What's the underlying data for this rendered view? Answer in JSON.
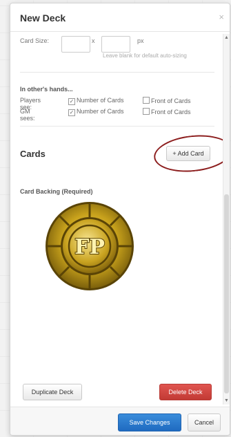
{
  "dialog": {
    "title": "New Deck",
    "close_glyph": "×"
  },
  "card_size": {
    "label": "Card Size:",
    "separator": "x",
    "unit": "px",
    "width_value": "",
    "height_value": "",
    "hint": "Leave blank for default auto-sizing"
  },
  "others_hands": {
    "title": "In other's hands...",
    "rows": [
      {
        "who": "Players see:",
        "number_of_cards": {
          "label": "Number of Cards",
          "checked": true
        },
        "front_of_cards": {
          "label": "Front of Cards",
          "checked": false
        }
      },
      {
        "who": "GM sees:",
        "number_of_cards": {
          "label": "Number of Cards",
          "checked": true
        },
        "front_of_cards": {
          "label": "Front of Cards",
          "checked": false
        }
      }
    ]
  },
  "cards": {
    "heading": "Cards",
    "add_card_label": "+ Add Card",
    "backing_label": "Card Backing (Required)",
    "backing_image": "fp-gold-token-icon"
  },
  "actions": {
    "duplicate_label": "Duplicate Deck",
    "delete_label": "Delete Deck",
    "save_label": "Save Changes",
    "cancel_label": "Cancel"
  },
  "colors": {
    "primary": "#2a7bcf",
    "danger": "#cf433d",
    "annotation": "#8c1d1d",
    "token_gold": "#c8a21c"
  }
}
